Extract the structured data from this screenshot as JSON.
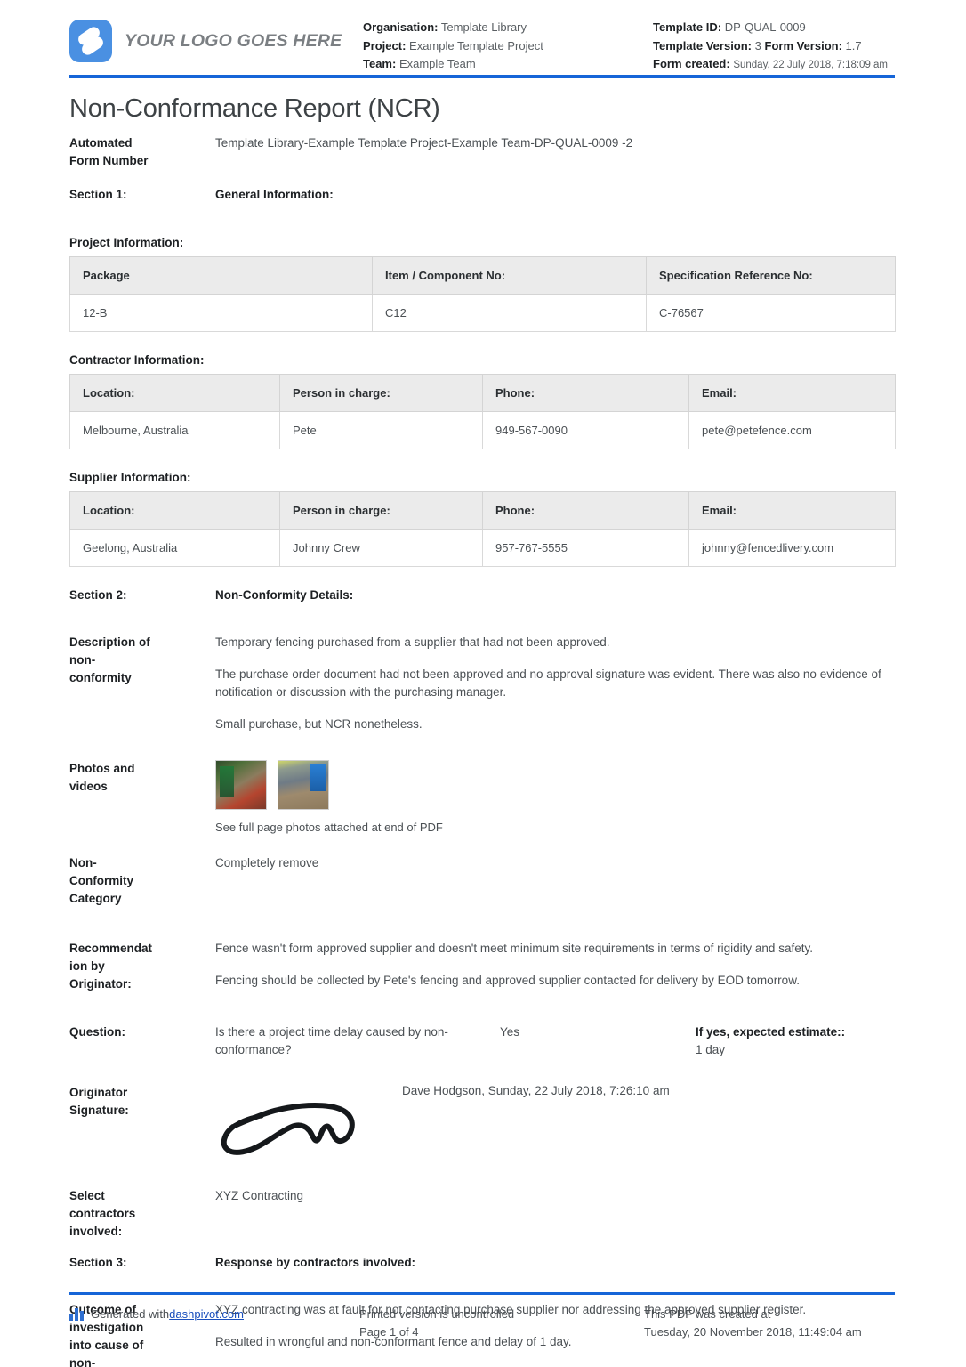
{
  "header": {
    "logo_text": "YOUR LOGO GOES HERE",
    "organisation_label": "Organisation:",
    "organisation_value": "Template Library",
    "project_label": "Project:",
    "project_value": "Example Template Project",
    "team_label": "Team:",
    "team_value": "Example Team",
    "template_id_label": "Template ID:",
    "template_id_value": "DP-QUAL-0009",
    "template_version_label": "Template Version:",
    "template_version_value": "3",
    "form_version_label": "Form Version:",
    "form_version_value": "1.7",
    "form_created_label": "Form created:",
    "form_created_value": "Sunday, 22 July 2018, 7:18:09 am"
  },
  "title": "Non-Conformance Report (NCR)",
  "automated_form": {
    "label_line1": "Automated",
    "label_line2": "Form Number",
    "value": "Template Library-Example Template Project-Example Team-DP-QUAL-0009   -2"
  },
  "section1": {
    "label": "Section 1:",
    "title": "General Information:"
  },
  "project_information": {
    "heading": "Project Information:",
    "columns": [
      "Package",
      "Item / Component No:",
      "Specification Reference No:"
    ],
    "rows": [
      [
        "12-B",
        "C12",
        "C-76567"
      ]
    ]
  },
  "contractor_information": {
    "heading": "Contractor Information:",
    "columns": [
      "Location:",
      "Person in charge:",
      "Phone:",
      "Email:"
    ],
    "rows": [
      [
        "Melbourne, Australia",
        "Pete",
        "949-567-0090",
        "pete@petefence.com"
      ]
    ]
  },
  "supplier_information": {
    "heading": "Supplier Information:",
    "columns": [
      "Location:",
      "Person in charge:",
      "Phone:",
      "Email:"
    ],
    "rows": [
      [
        "Geelong, Australia",
        "Johnny Crew",
        "957-767-5555",
        "johnny@fencedlivery.com"
      ]
    ]
  },
  "section2": {
    "label": "Section 2:",
    "title": "Non-Conformity Details:"
  },
  "description": {
    "label_line1": "Description of",
    "label_line2": "non-",
    "label_line3": "conformity",
    "paragraphs": [
      "Temporary fencing purchased from a supplier that had not been approved.",
      "The purchase order document had not been approved and no approval signature was evident. There was also no evidence of notification or discussion with the purchasing manager.",
      "Small purchase, but NCR nonetheless."
    ]
  },
  "photos": {
    "label_line1": "Photos and",
    "label_line2": "videos",
    "caption": "See full page photos attached at end of PDF",
    "thumbnails": [
      "photo-thumbnail-1",
      "photo-thumbnail-2"
    ]
  },
  "category": {
    "label_line1": "Non-",
    "label_line2": "Conformity",
    "label_line3": "Category",
    "value": "Completely remove"
  },
  "recommendation": {
    "label_line1": "Recommendat",
    "label_line2": "ion by",
    "label_line3": "Originator:",
    "paragraphs": [
      "Fence wasn't form approved supplier and doesn't meet minimum site requirements in terms of rigidity and safety.",
      "Fencing should be collected by Pete's fencing and approved supplier contacted for delivery by EOD tomorrow."
    ]
  },
  "question": {
    "label": "Question:",
    "text": "Is there a project time delay caused by non-conformance?",
    "answer": "Yes",
    "extra_label": "If yes, expected estimate::",
    "extra_value": "1 day"
  },
  "signature": {
    "label_line1": "Originator",
    "label_line2": "Signature:",
    "meta": "Dave Hodgson, Sunday, 22 July 2018, 7:26:10 am",
    "image_name": "originator-signature-image"
  },
  "contractors_involved": {
    "label_line1": "Select",
    "label_line2": "contractors",
    "label_line3": "involved:",
    "value": "XYZ Contracting"
  },
  "section3": {
    "label": "Section 3:",
    "title": "Response by contractors involved:"
  },
  "outcome": {
    "label_line1": "Outcome of",
    "label_line2": "investigation",
    "label_line3": "into cause of",
    "label_line4": "non-",
    "paragraphs": [
      "XYZ contracting was at fault for not contacting purchase supplier nor addressing the approved supplier register.",
      "Resulted in wrongful and non-conformant fence and delay of 1 day."
    ]
  },
  "footer": {
    "generated_prefix": "Generated with ",
    "generated_link": "dashpivot.com",
    "printed_line1": "Printed version is uncontrolled",
    "printed_line2": "Page 1 of 4",
    "created_line1": "This PDF was created at",
    "created_line2": "Tuesday, 20 November 2018, 11:49:04 am"
  },
  "colors": {
    "accent_blue": "#1565d8",
    "logo_blue": "#4a90e2",
    "link_blue": "#1a4fbd",
    "table_header_gray": "#ebebeb"
  }
}
